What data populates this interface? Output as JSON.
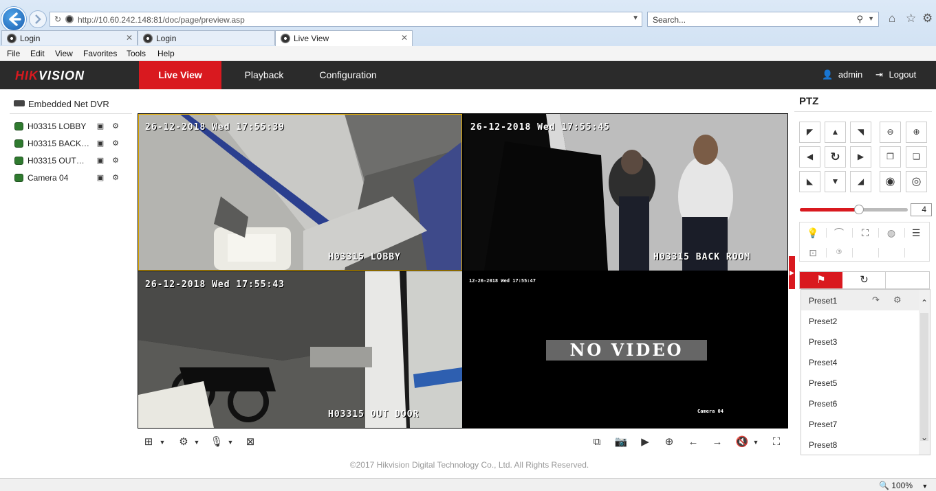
{
  "browser": {
    "address": "http://10.60.242.148:81/doc/page/preview.asp",
    "search_placeholder": "Search...",
    "tabs": [
      {
        "label": "Login"
      },
      {
        "label": "Login"
      },
      {
        "label": "Live View"
      }
    ],
    "menu": [
      "File",
      "Edit",
      "View",
      "Favorites",
      "Tools",
      "Help"
    ],
    "zoom": "100%"
  },
  "app": {
    "logo": {
      "hik": "HIK",
      "vision": "VISION"
    },
    "nav": [
      "Live View",
      "Playback",
      "Configuration"
    ],
    "active_nav": "Live View",
    "user": "admin",
    "logout": "Logout"
  },
  "tree": {
    "root": "Embedded Net DVR",
    "cameras": [
      {
        "label": "H03315 LOBBY"
      },
      {
        "label": "H03315 BACK…"
      },
      {
        "label": "H03315 OUT…"
      },
      {
        "label": "Camera 04"
      }
    ]
  },
  "video": {
    "cells": [
      {
        "timestamp": "26-12-2018 Wed 17:55:39",
        "name": "H03315 LOBBY"
      },
      {
        "timestamp": "26-12-2018 Wed 17:55:45",
        "name": "H03315 BACK ROOM"
      },
      {
        "timestamp": "26-12-2018 Wed 17:55:43",
        "name": "H03315 OUT DOOR"
      },
      {
        "timestamp": "12-26-2018 Wed 17:55:47",
        "name": "Camera 04",
        "no_video": "NO VIDEO"
      }
    ]
  },
  "footer": "©2017 Hikvision Digital Technology Co., Ltd. All Rights Reserved.",
  "ptz": {
    "title": "PTZ",
    "speed": "4",
    "speed_level": 0.55,
    "presets": [
      "Preset1",
      "Preset2",
      "Preset3",
      "Preset4",
      "Preset5",
      "Preset6",
      "Preset7",
      "Preset8"
    ]
  },
  "colors": {
    "accent": "#d9191f",
    "header_bg": "#2b2b2b"
  }
}
